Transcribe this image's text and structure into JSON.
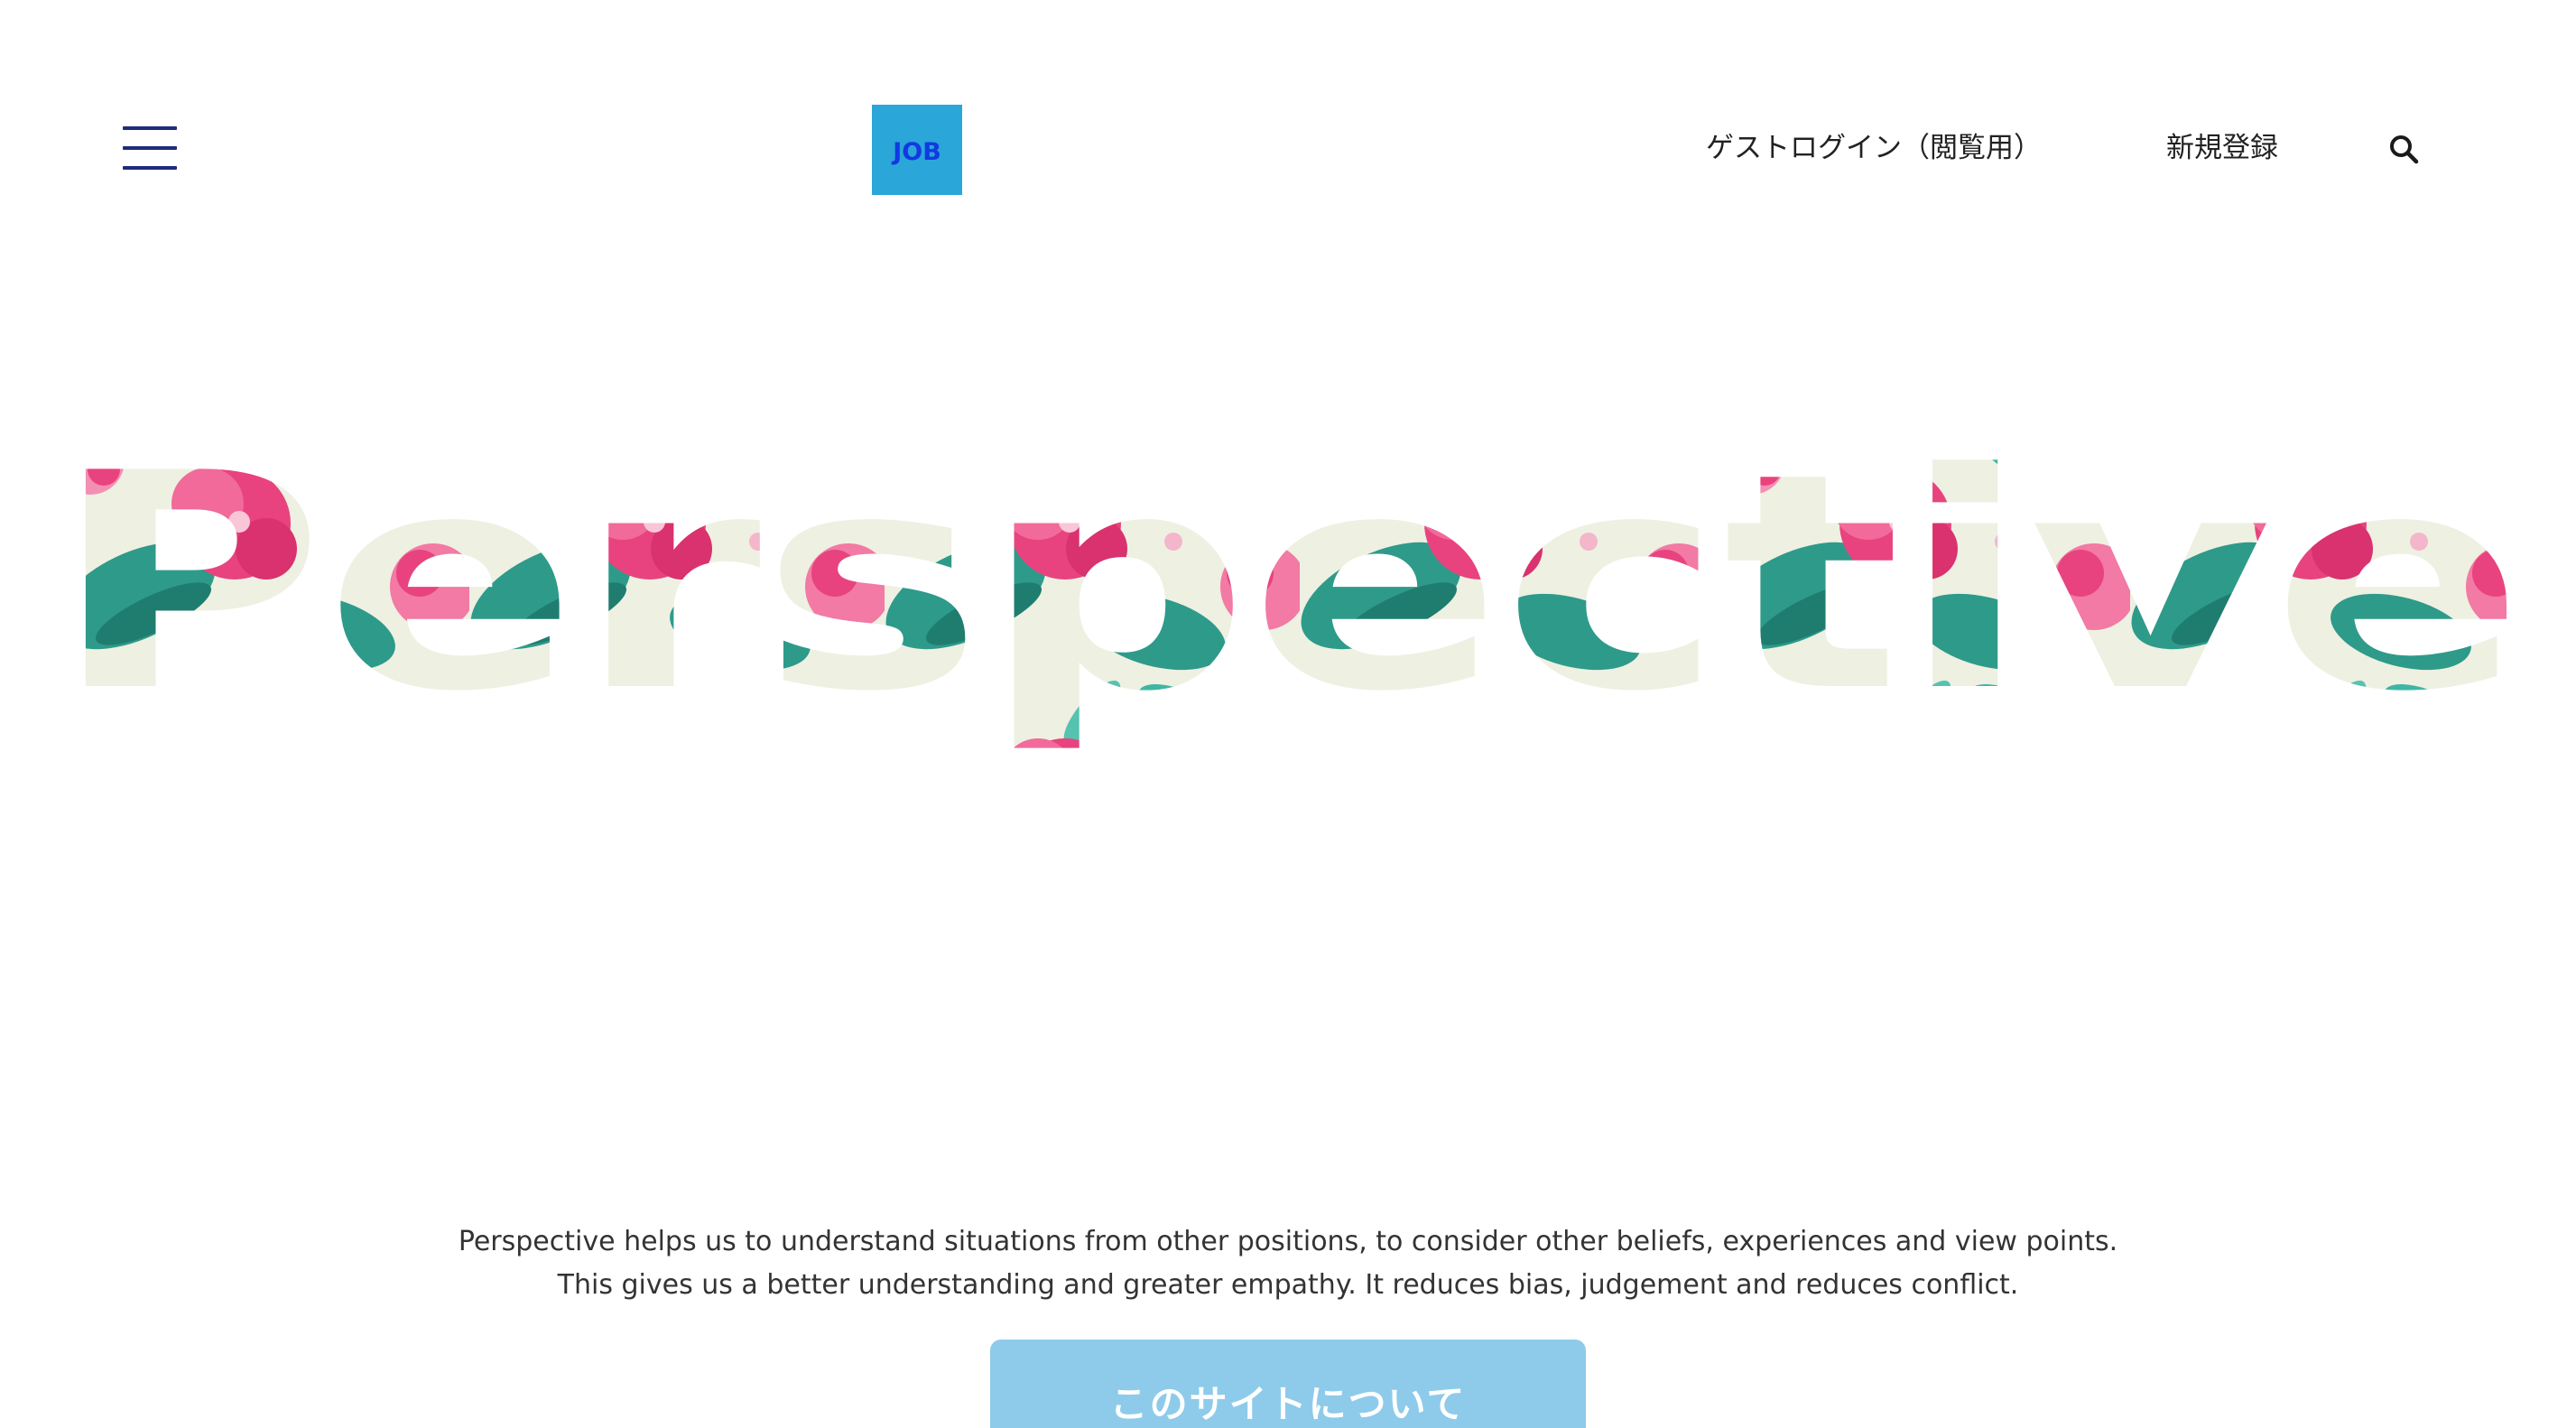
{
  "header": {
    "menu_icon": "hamburger-menu-icon",
    "logo_text": "JOB",
    "nav": {
      "guest_login": "ゲストログイン（閲覧用）",
      "register": "新規登録"
    },
    "search_icon": "search-icon"
  },
  "hero": {
    "title": "Perspective"
  },
  "description": {
    "line1": "Perspective helps us to understand situations from other positions, to consider other beliefs, experiences and view points.",
    "line2": "This gives us a better understanding and greater empathy. It reduces bias, judgement and reduces conflict."
  },
  "cta": {
    "about_label": "このサイトについて"
  },
  "colors": {
    "logo_bg": "#2aa6d9",
    "logo_text": "#1239e2",
    "menu_icon": "#1e2c7a",
    "cta_bg": "#8ecbea",
    "floral_cream": "#eef0e2",
    "floral_pink": "#e8437e",
    "floral_teal": "#2e9a8a"
  }
}
